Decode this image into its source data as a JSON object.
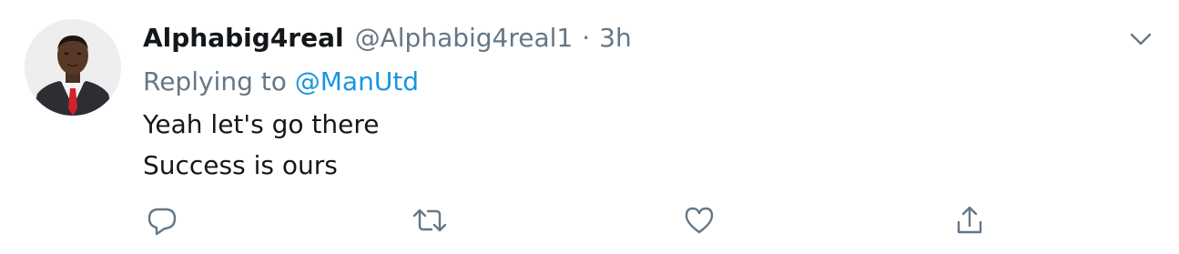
{
  "tweet": {
    "display_name": "Alphabig4real",
    "handle": "@Alphabig4real1",
    "separator": "·",
    "time": "3h",
    "replying_prefix": "Replying to",
    "replying_to": "@ManUtd",
    "lines": [
      "Yeah let's go there",
      "Success is ours"
    ]
  },
  "icons": {
    "menu": "chevron-down-icon",
    "reply": "reply-icon",
    "retweet": "retweet-icon",
    "like": "heart-icon",
    "share": "share-icon"
  },
  "colors": {
    "text": "#14171a",
    "muted": "#657786",
    "link": "#1b95e0"
  }
}
